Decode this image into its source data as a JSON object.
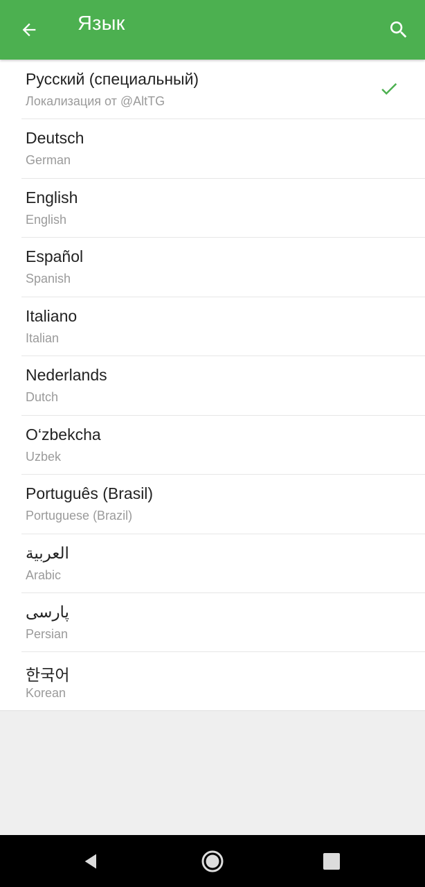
{
  "header": {
    "title": "Язык",
    "back_icon": "arrow-back-icon",
    "search_icon": "search-icon"
  },
  "colors": {
    "appbar": "#4cb050",
    "check": "#4cb050",
    "primary_text": "#222222",
    "secondary_text": "#9a9a9a",
    "background": "#efefef"
  },
  "languages": [
    {
      "name": "Русский (специальный)",
      "sub": "Локализация от @AltTG",
      "selected": true
    },
    {
      "name": "Deutsch",
      "sub": "German",
      "selected": false
    },
    {
      "name": "English",
      "sub": "English",
      "selected": false
    },
    {
      "name": "Español",
      "sub": "Spanish",
      "selected": false
    },
    {
      "name": "Italiano",
      "sub": "Italian",
      "selected": false
    },
    {
      "name": "Nederlands",
      "sub": "Dutch",
      "selected": false
    },
    {
      "name": "O‘zbekcha",
      "sub": "Uzbek",
      "selected": false
    },
    {
      "name": "Português (Brasil)",
      "sub": "Portuguese (Brazil)",
      "selected": false
    },
    {
      "name": "العربية",
      "sub": "Arabic",
      "selected": false
    },
    {
      "name": "پارسی",
      "sub": "Persian",
      "selected": false
    },
    {
      "name": "한국어",
      "sub": "Korean",
      "selected": false
    }
  ],
  "system_nav": {
    "back_icon": "nav-back-icon",
    "home_icon": "nav-home-icon",
    "recents_icon": "nav-recents-icon"
  }
}
